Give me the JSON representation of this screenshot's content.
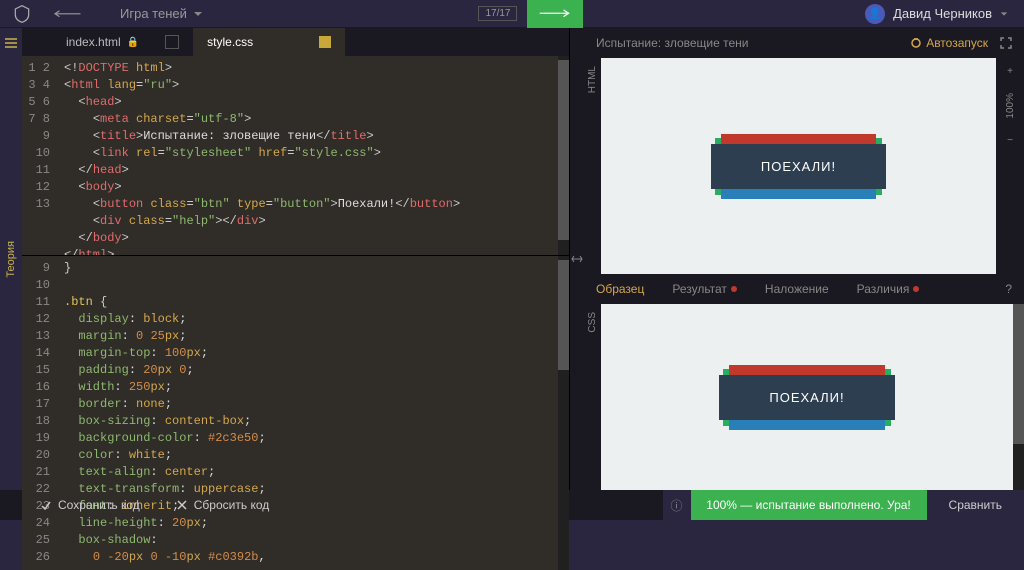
{
  "header": {
    "breadcrumb": "Игра теней",
    "progress": "17/17",
    "user": "Давид Черников"
  },
  "tabs": {
    "html": "index.html",
    "css": "style.css"
  },
  "html_code": {
    "lines": [
      "1",
      "2",
      "3",
      "4",
      "5",
      "6",
      "7",
      "8",
      "9",
      "10",
      "11",
      "12",
      "13"
    ]
  },
  "css_code": {
    "lines": [
      "9",
      "10",
      "11",
      "12",
      "13",
      "14",
      "15",
      "16",
      "17",
      "18",
      "19",
      "20",
      "21",
      "22",
      "23",
      "24",
      "25",
      "26"
    ]
  },
  "preview": {
    "title": "Испытание: зловещие тени",
    "autostart": "Автозапуск",
    "button_text": "ПОЕХАЛИ!",
    "html_label": "HTML",
    "css_label": "CSS"
  },
  "compare": {
    "sample": "Образец",
    "result": "Результат",
    "overlay": "Наложение",
    "diff": "Различия"
  },
  "zoom": {
    "value": "100%"
  },
  "footer": {
    "save": "Сохранить код",
    "reset": "Сбросить код",
    "status": "100% — испытание выполнено. Ура!",
    "compare": "Сравнить"
  },
  "sidebar": {
    "theory": "Теория"
  }
}
